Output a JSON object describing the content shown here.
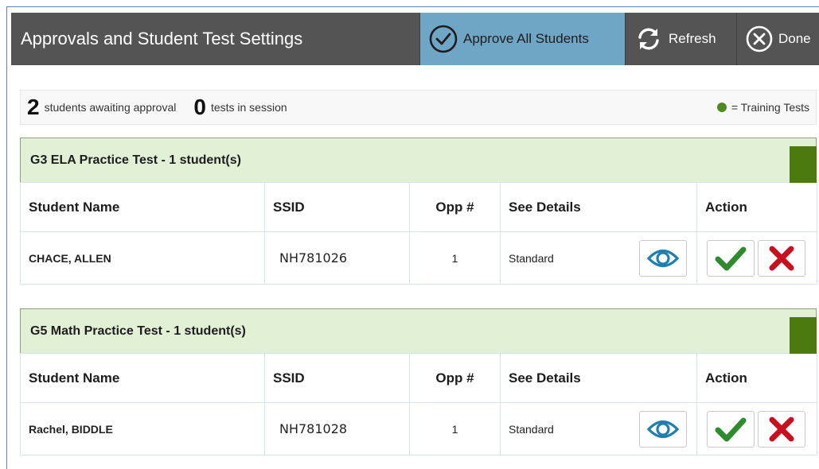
{
  "header": {
    "title": "Approvals and Student Test Settings",
    "approve_all_label": "Approve All Students",
    "refresh_label": "Refresh",
    "done_label": "Done"
  },
  "status": {
    "awaiting_count": "2",
    "awaiting_label": "students awaiting approval",
    "in_session_count": "0",
    "in_session_label": "tests in session",
    "legend_label": "= Training Tests",
    "legend_color": "#4e8b1f"
  },
  "columns": {
    "name": "Student Name",
    "ssid": "SSID",
    "opp": "Opp #",
    "details": "See Details",
    "action": "Action"
  },
  "groups": [
    {
      "title": "G3 ELA Practice Test - 1 student(s)",
      "rows": [
        {
          "name": "CHACE, ALLEN",
          "ssid": "NH781026",
          "opp": "1",
          "details": "Standard"
        }
      ]
    },
    {
      "title": "G5 Math Practice Test - 1 student(s)",
      "rows": [
        {
          "name": "Rachel, BIDDLE",
          "ssid": "NH781028",
          "opp": "1",
          "details": "Standard"
        }
      ]
    }
  ],
  "colors": {
    "header_bg": "#545454",
    "approve_bg": "#6fa6c6",
    "group_bg": "#e2f0d6",
    "group_marker": "#4d7a0f",
    "approve_check": "#2e8b2e",
    "deny_x": "#c8101e",
    "eye": "#1f7fae"
  },
  "icons": {
    "approve_all": "check-circle-icon",
    "refresh": "refresh-icon",
    "done": "close-circle-icon",
    "details": "eye-icon",
    "approve": "checkmark-icon",
    "deny": "x-icon"
  }
}
